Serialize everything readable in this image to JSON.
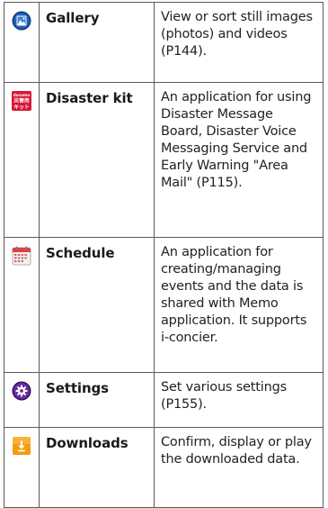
{
  "rows": [
    {
      "icon": "gallery-icon",
      "name": "Gallery",
      "description": "View or sort still images (photos) and videos (P144)."
    },
    {
      "icon": "disaster-kit-icon",
      "icon_text": [
        "docomo",
        "災害用",
        "キット"
      ],
      "name": "Disaster kit",
      "description": "An application for using Disaster Message Board, Disaster Voice Messaging Service and Early Warning \"Area Mail\" (P115)."
    },
    {
      "icon": "schedule-calendar-icon",
      "name": "Schedule",
      "description": "An application for creating/managing events and the data is shared with Memo application. It supports i-concier."
    },
    {
      "icon": "settings-gear-icon",
      "name": "Settings",
      "description": "Set various settings (P155)."
    },
    {
      "icon": "downloads-arrow-icon",
      "name": "Downloads",
      "description": "Confirm, display or play the downloaded data."
    }
  ],
  "colors": {
    "border": "#5a5a5a",
    "gallery_blue": "#1f5fb8",
    "disaster_red": "#d8173a",
    "schedule_red": "#e04040",
    "settings_purple": "#6a2aa0",
    "downloads_orange": "#f39c12"
  }
}
